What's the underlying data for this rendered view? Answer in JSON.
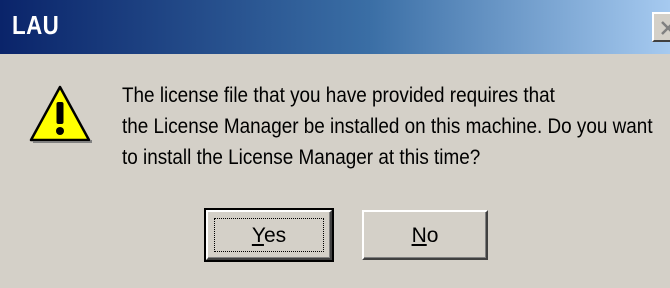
{
  "window": {
    "title": "LAU"
  },
  "title_bar": {
    "close_icon": "close-icon"
  },
  "message": {
    "icon": "warning-icon",
    "lines": [
      "The license file that you have provided requires that",
      "the License Manager be installed on this machine.  Do you want",
      "to install the License Manager at this time?"
    ]
  },
  "buttons": {
    "yes": {
      "accelerator": "Y",
      "rest": "es"
    },
    "no": {
      "accelerator": "N",
      "rest": "o"
    }
  },
  "colors": {
    "title_bar_start": "#0a246a",
    "title_bar_end": "#a6caf0",
    "dialog_face": "#d4d0c8",
    "warning_yellow": "#ffff00"
  }
}
